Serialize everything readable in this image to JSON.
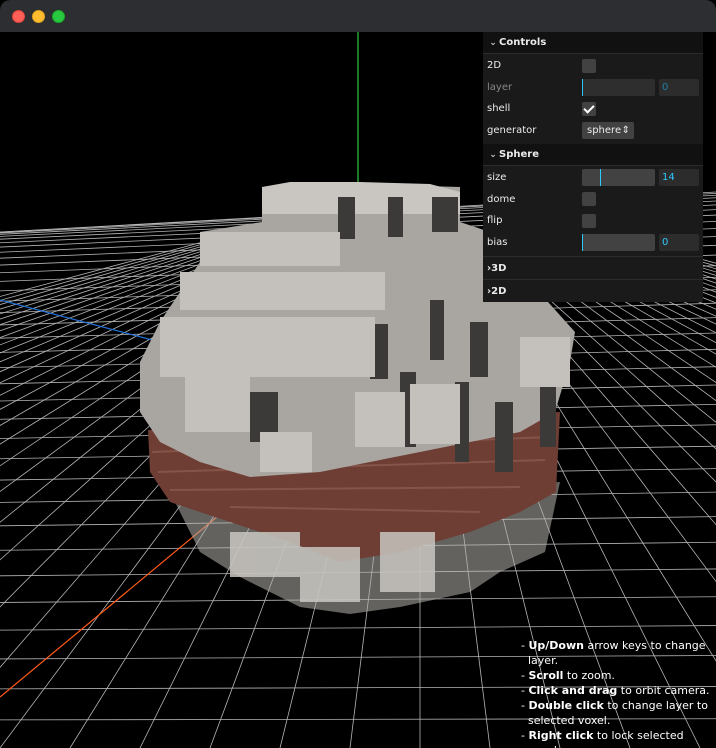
{
  "window": {
    "title": ""
  },
  "gui": {
    "controls": {
      "title": "Controls",
      "mode_2d": {
        "label": "2D",
        "checked": false
      },
      "layer": {
        "label": "layer",
        "value": "0",
        "level": 0,
        "disabled": true
      },
      "shell": {
        "label": "shell",
        "checked": true
      },
      "generator": {
        "label": "generator",
        "value": "sphere"
      }
    },
    "sphere": {
      "title": "Sphere",
      "size": {
        "label": "size",
        "value": "14",
        "level": 0.26
      },
      "dome": {
        "label": "dome",
        "checked": false
      },
      "flip": {
        "label": "flip",
        "checked": false
      },
      "bias": {
        "label": "bias",
        "value": "0",
        "level": 0
      }
    },
    "folder_3d": {
      "title": "3D"
    },
    "folder_2d": {
      "title": "2D"
    }
  },
  "help": [
    {
      "key": "Up/Down",
      "text": " arrow keys to change layer."
    },
    {
      "key": "Scroll",
      "text": " to zoom."
    },
    {
      "key": "Click and drag",
      "text": " to orbit camera."
    },
    {
      "key": "Double click",
      "text": " to change layer to selected voxel."
    },
    {
      "key": "Right click",
      "text": " to lock selected voxel."
    }
  ],
  "colors": {
    "accent": "#2cc9ff",
    "voxel_stone": "#a9a6a1",
    "voxel_wood": "#6e3d33",
    "axis_x": "#ff5a1a",
    "axis_y": "#2ecc40",
    "axis_z": "#1f6fd6"
  }
}
